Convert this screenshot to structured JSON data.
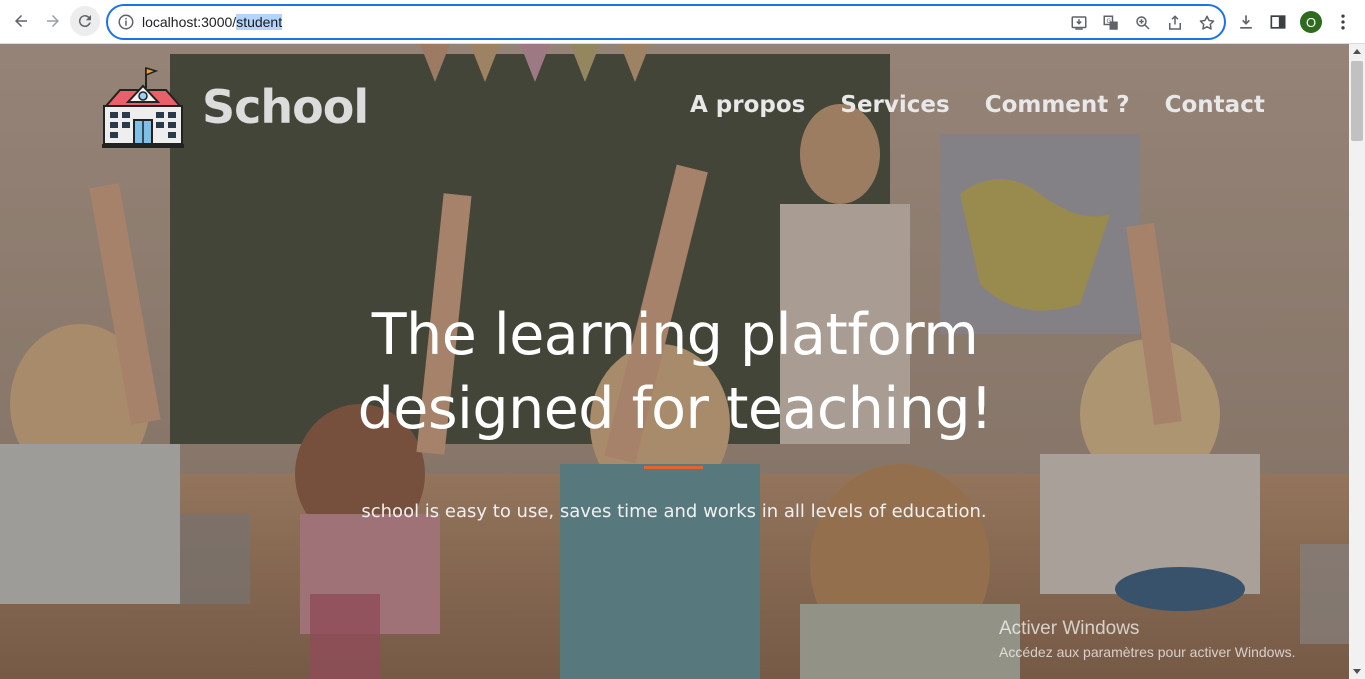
{
  "browser": {
    "url_host": "localhost:3000/",
    "url_path": "student",
    "avatar_letter": "O",
    "accent_color": "#1a73e8",
    "icons": {
      "back": "arrow-left-icon",
      "forward": "arrow-right-icon",
      "reload": "reload-icon",
      "site_info": "info-icon",
      "install": "install-app-icon",
      "translate": "translate-icon",
      "zoom": "zoom-icon",
      "share": "share-icon",
      "bookmark": "star-icon",
      "downloads": "download-icon",
      "side_panel": "side-panel-icon",
      "menu": "kebab-menu-icon"
    }
  },
  "site": {
    "brand": "School",
    "nav": [
      "A propos",
      "Services",
      "Comment ?",
      "Contact"
    ],
    "hero_title_line1": "The learning platform",
    "hero_title_line2": "designed for teaching!",
    "hero_subtitle": "school is easy to use, saves time and works in all levels of education.",
    "accent_color": "#e8622c"
  },
  "watermark": {
    "title": "Activer Windows",
    "subtitle": "Accédez aux paramètres pour activer Windows."
  }
}
